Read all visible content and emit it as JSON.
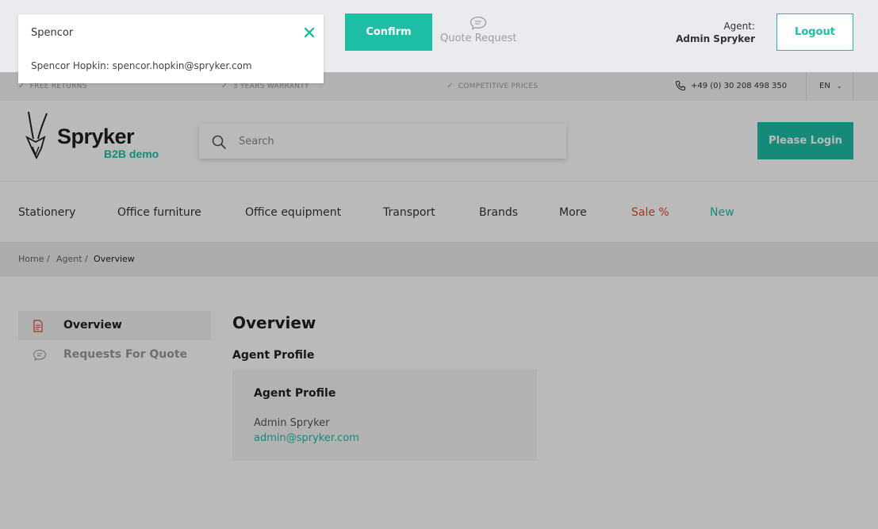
{
  "agent_bar": {
    "customer_search": {
      "value": "Spencor",
      "suggestion": "Spencor Hopkin: spencor.hopkin@spryker.com",
      "clear_icon": "close-icon"
    },
    "confirm_label": "Confirm",
    "quote_request_label": "Quote Request",
    "quote_request_icon": "speech-bubble-icon",
    "agent_label": "Agent:",
    "agent_name": "Admin Spryker",
    "logout_label": "Logout"
  },
  "top_strip": {
    "benefits": [
      "FREE RETURNS",
      "3 YEARS WARRANTY",
      "COMPETITIVE PRICES"
    ],
    "phone": "+49 (0) 30 208 498 350",
    "language": "EN"
  },
  "header": {
    "logo_text": "Spryker",
    "logo_subtext": "B2B demo",
    "search_placeholder": "Search",
    "login_label": "Please Login"
  },
  "nav": {
    "items": [
      {
        "label": "Stationery"
      },
      {
        "label": "Office furniture"
      },
      {
        "label": "Office equipment"
      },
      {
        "label": "Transport"
      },
      {
        "label": "Brands"
      },
      {
        "label": "More"
      },
      {
        "label": "Sale %"
      },
      {
        "label": "New"
      }
    ]
  },
  "breadcrumbs": [
    "Home /",
    "Agent /",
    "Overview"
  ],
  "sidebar": {
    "items": [
      {
        "label": "Overview",
        "icon": "document-icon",
        "active": true
      },
      {
        "label": "Requests For Quote",
        "icon": "speech-bubble-icon",
        "active": false
      }
    ]
  },
  "main": {
    "title": "Overview",
    "section_title": "Agent Profile",
    "card": {
      "title": "Agent Profile",
      "name": "Admin Spryker",
      "email": "admin@spryker.com"
    }
  },
  "colors": {
    "accent": "#1ebea5",
    "sale": "#e8472e",
    "new": "#1ebea5",
    "agent_bar_bg": "#e9ebee",
    "overlay": "rgba(0,0,0,0.27)"
  }
}
